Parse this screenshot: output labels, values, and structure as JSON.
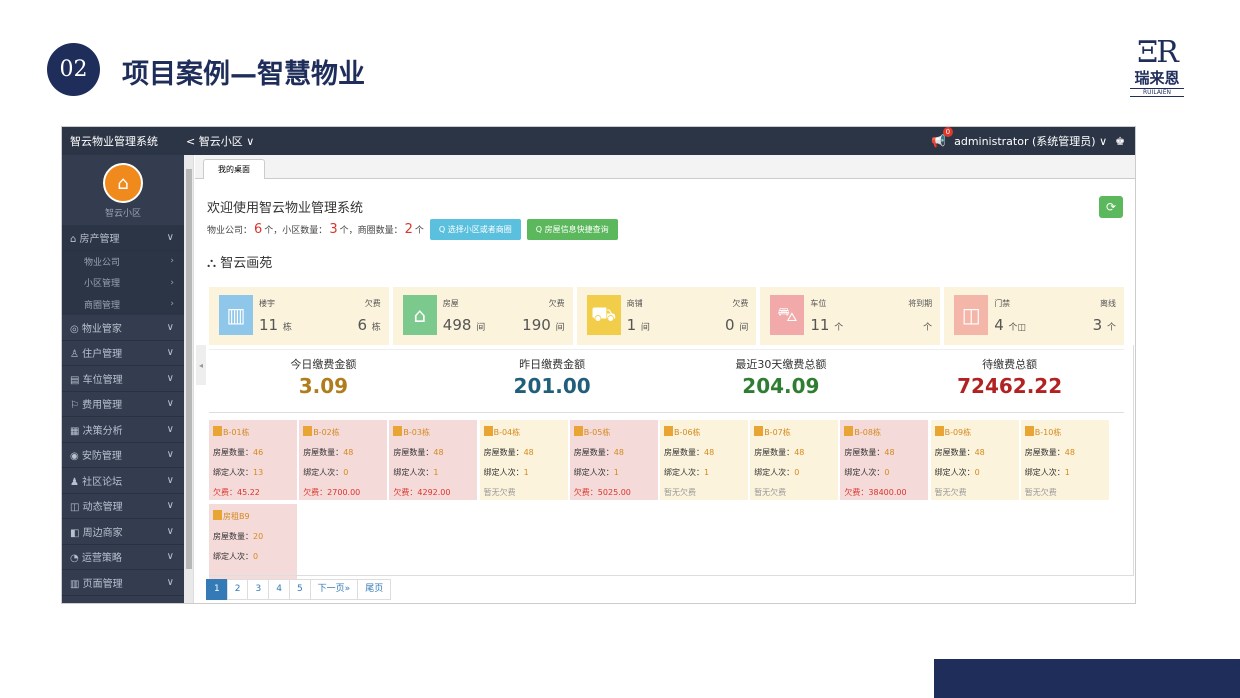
{
  "slide": {
    "number": "02",
    "title": "项目案例—智慧物业"
  },
  "logo": {
    "mark": "ΞR",
    "cn": "瑞来恩",
    "en": "RUILAIEN"
  },
  "topbar": {
    "app_name": "智云物业管理系统",
    "community": "< 智云小区 ∨",
    "badge": "0",
    "user": "administrator (系统管理员) ∨",
    "shirt": "♚"
  },
  "sidebar": {
    "avatar_label": "智云小区",
    "items": [
      {
        "label": "房产管理",
        "icon": "⌂",
        "open": true,
        "sub": [
          "物业公司",
          "小区管理",
          "商圈管理"
        ]
      },
      {
        "label": "物业管家",
        "icon": "◎"
      },
      {
        "label": "住户管理",
        "icon": "♙"
      },
      {
        "label": "车位管理",
        "icon": "▤"
      },
      {
        "label": "费用管理",
        "icon": "⚐"
      },
      {
        "label": "决策分析",
        "icon": "▦"
      },
      {
        "label": "安防管理",
        "icon": "◉"
      },
      {
        "label": "社区论坛",
        "icon": "♟"
      },
      {
        "label": "动态管理",
        "icon": "◫"
      },
      {
        "label": "周边商家",
        "icon": "◧"
      },
      {
        "label": "运营策略",
        "icon": "◔"
      },
      {
        "label": "页面管理",
        "icon": "▥"
      }
    ]
  },
  "main": {
    "tab": "我的桌面",
    "welcome": "欢迎使用智云物业管理系统",
    "stats": {
      "company_label": "物业公司：",
      "company_num": "6",
      "community_label": "个，小区数量：",
      "community_num": "3",
      "mall_label": "个，商圈数量：",
      "mall_num": "2",
      "tail": "个"
    },
    "btn_select": "Q 选择小区或者商圈",
    "btn_query": "Q 房屋信息快捷查询",
    "section": "智云画苑",
    "summary": [
      {
        "icon": "▥",
        "color": "#8ec7ea",
        "l1": "楼宇",
        "v1": "11",
        "u1": "栋",
        "l2": "欠费",
        "v2": "6",
        "u2": "栋"
      },
      {
        "icon": "⌂",
        "color": "#7cc98d",
        "l1": "房屋",
        "v1": "498",
        "u1": "间",
        "l2": "欠费",
        "v2": "190",
        "u2": "间"
      },
      {
        "icon": "⛟",
        "color": "#f2cd4a",
        "l1": "商铺",
        "v1": "1",
        "u1": "间",
        "l2": "欠费",
        "v2": "0",
        "u2": "间"
      },
      {
        "icon": "⛍",
        "color": "#f1a9a9",
        "l1": "车位",
        "v1": "11",
        "u1": "个",
        "l2": "将到期",
        "v2": "",
        "u2": "个"
      },
      {
        "icon": "◫",
        "color": "#f3b6a8",
        "l1": "门禁",
        "v1": "4",
        "u1": "个◫",
        "l2": "离线",
        "v2": "3",
        "u2": "个"
      }
    ],
    "money": [
      {
        "label": "今日缴费金额",
        "value": "3.09",
        "color": "#b07d1c"
      },
      {
        "label": "昨日缴费金额",
        "value": "201.00",
        "color": "#1f5f7a"
      },
      {
        "label": "最近30天缴费总额",
        "value": "204.09",
        "color": "#2e7d32"
      },
      {
        "label": "待缴费总额",
        "value": "72462.22",
        "color": "#b22222"
      }
    ],
    "buildings": [
      {
        "name": "B-01栋",
        "count_label": "房屋数量：",
        "count": "46",
        "bind_label": "绑定人次：",
        "bind": "13",
        "fee": "欠费：45.22",
        "state": "owe"
      },
      {
        "name": "B-02栋",
        "count_label": "房屋数量：",
        "count": "48",
        "bind_label": "绑定人次：",
        "bind": "0",
        "fee": "欠费：2700.00",
        "state": "owe"
      },
      {
        "name": "B-03栋",
        "count_label": "房屋数量：",
        "count": "48",
        "bind_label": "绑定人次：",
        "bind": "1",
        "fee": "欠费：4292.00",
        "state": "owe"
      },
      {
        "name": "B-04栋",
        "count_label": "房屋数量：",
        "count": "48",
        "bind_label": "绑定人次：",
        "bind": "1",
        "fee": "暂无欠费",
        "state": "none"
      },
      {
        "name": "B-05栋",
        "count_label": "房屋数量：",
        "count": "48",
        "bind_label": "绑定人次：",
        "bind": "1",
        "fee": "欠费：5025.00",
        "state": "owe"
      },
      {
        "name": "B-06栋",
        "count_label": "房屋数量：",
        "count": "48",
        "bind_label": "绑定人次：",
        "bind": "1",
        "fee": "暂无欠费",
        "state": "none"
      },
      {
        "name": "B-07栋",
        "count_label": "房屋数量：",
        "count": "48",
        "bind_label": "绑定人次：",
        "bind": "0",
        "fee": "暂无欠费",
        "state": "none"
      },
      {
        "name": "B-08栋",
        "count_label": "房屋数量：",
        "count": "48",
        "bind_label": "绑定人次：",
        "bind": "0",
        "fee": "欠费：38400.00",
        "state": "owe"
      },
      {
        "name": "B-09栋",
        "count_label": "房屋数量：",
        "count": "48",
        "bind_label": "绑定人次：",
        "bind": "0",
        "fee": "暂无欠费",
        "state": "none"
      },
      {
        "name": "B-10栋",
        "count_label": "房屋数量：",
        "count": "48",
        "bind_label": "绑定人次：",
        "bind": "1",
        "fee": "暂无欠费",
        "state": "none"
      },
      {
        "name": "房租B9",
        "count_label": "房屋数量：",
        "count": "20",
        "bind_label": "绑定人次：",
        "bind": "0",
        "fee": "",
        "state": "owe"
      }
    ],
    "pager": [
      "1",
      "2",
      "3",
      "4",
      "5",
      "下一页»",
      "尾页"
    ]
  }
}
